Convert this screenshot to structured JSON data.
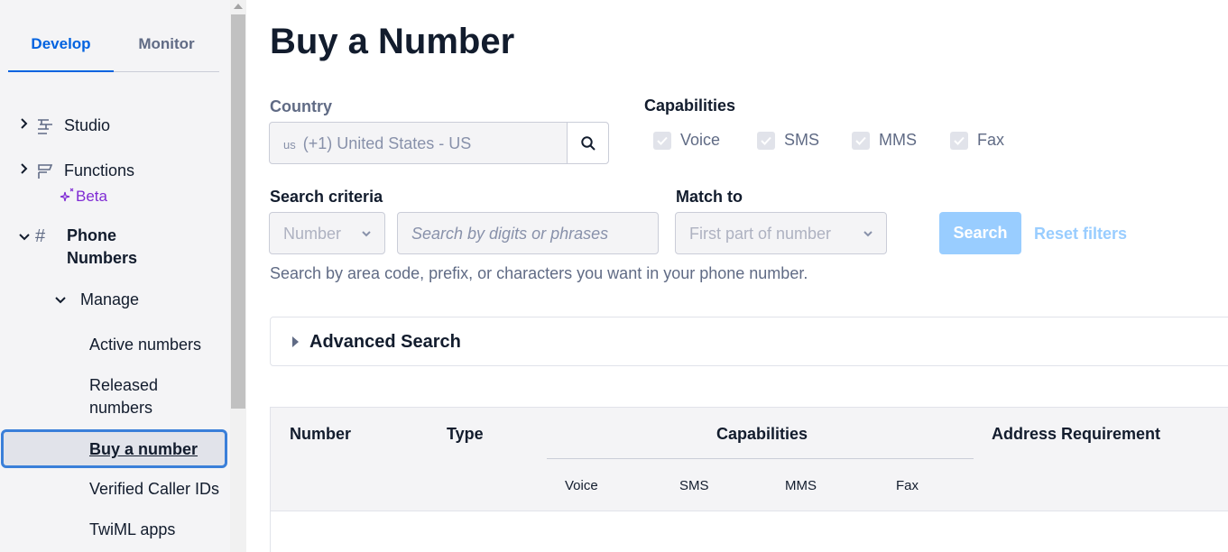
{
  "sidebar": {
    "tabs": [
      {
        "label": "Develop"
      },
      {
        "label": "Monitor"
      }
    ],
    "items": [
      {
        "label": "Studio"
      },
      {
        "label": "Functions",
        "badge": "Beta"
      },
      {
        "label": "Phone\nNumbers"
      }
    ],
    "manage_label": "Manage",
    "sub_links": [
      "Active numbers",
      "Released numbers",
      "Buy a number",
      "Verified Caller IDs",
      "TwiML apps"
    ]
  },
  "main": {
    "title": "Buy a Number",
    "country": {
      "label": "Country",
      "flag_code": "us",
      "value": "(+1) United States - US"
    },
    "capabilities": {
      "label": "Capabilities",
      "items": [
        "Voice",
        "SMS",
        "MMS",
        "Fax"
      ]
    },
    "search_criteria": {
      "label": "Search criteria",
      "select_value": "Number",
      "input_placeholder": "Search by digits or phrases"
    },
    "match_to": {
      "label": "Match to",
      "select_value": "First part of number"
    },
    "search_button": "Search",
    "reset_button": "Reset filters",
    "help_text": "Search by area code, prefix, or characters you want in your phone number.",
    "advanced_search": "Advanced Search",
    "table": {
      "columns": [
        "Number",
        "Type",
        "Capabilities",
        "Address Requirement"
      ],
      "capability_columns": [
        "Voice",
        "SMS",
        "MMS",
        "Fax"
      ]
    }
  },
  "colors": {
    "accent": "#0263e0",
    "beta": "#7f2bd4",
    "disabled_button": "#99cdff"
  }
}
